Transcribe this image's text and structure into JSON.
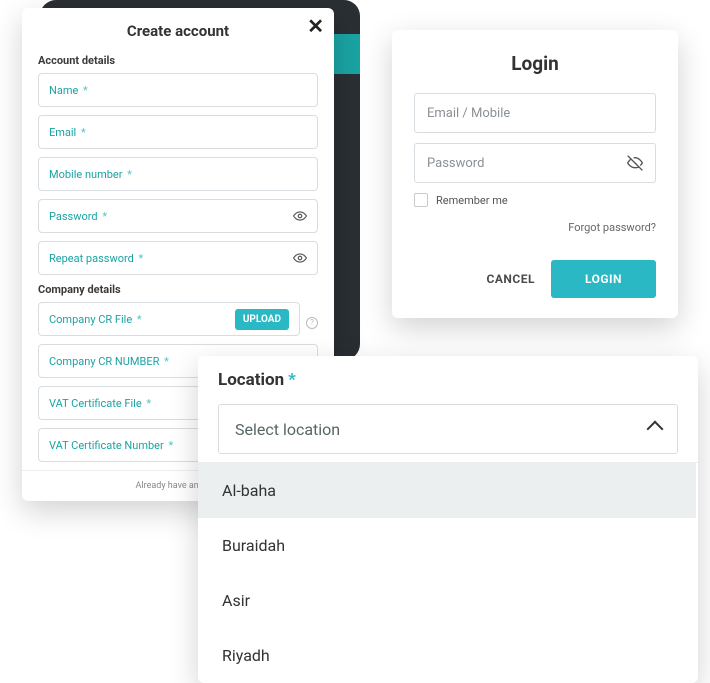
{
  "create": {
    "title": "Create account",
    "section_account": "Account details",
    "section_company": "Company details",
    "fields": {
      "name": "Name",
      "email": "Email",
      "mobile": "Mobile number",
      "password": "Password",
      "repeat_password": "Repeat password",
      "cr_file": "Company CR File",
      "cr_number": "Company CR NUMBER",
      "vat_file": "VAT Certificate File",
      "vat_number": "VAT Certificate Number"
    },
    "upload_label": "UPLOAD",
    "already_text": "Already have an acco"
  },
  "login": {
    "title": "Login",
    "email_placeholder": "Email / Mobile",
    "password_placeholder": "Password",
    "remember_label": "Remember me",
    "forgot_label": "Forgot password?",
    "cancel_label": "CANCEL",
    "login_label": "LOGIN"
  },
  "location": {
    "title": "Location",
    "asterisk": "*",
    "select_placeholder": "Select location",
    "options": [
      "Al-baha",
      "Buraidah",
      "Asir",
      "Riyadh"
    ]
  },
  "colors": {
    "accent": "#29b8c4"
  }
}
